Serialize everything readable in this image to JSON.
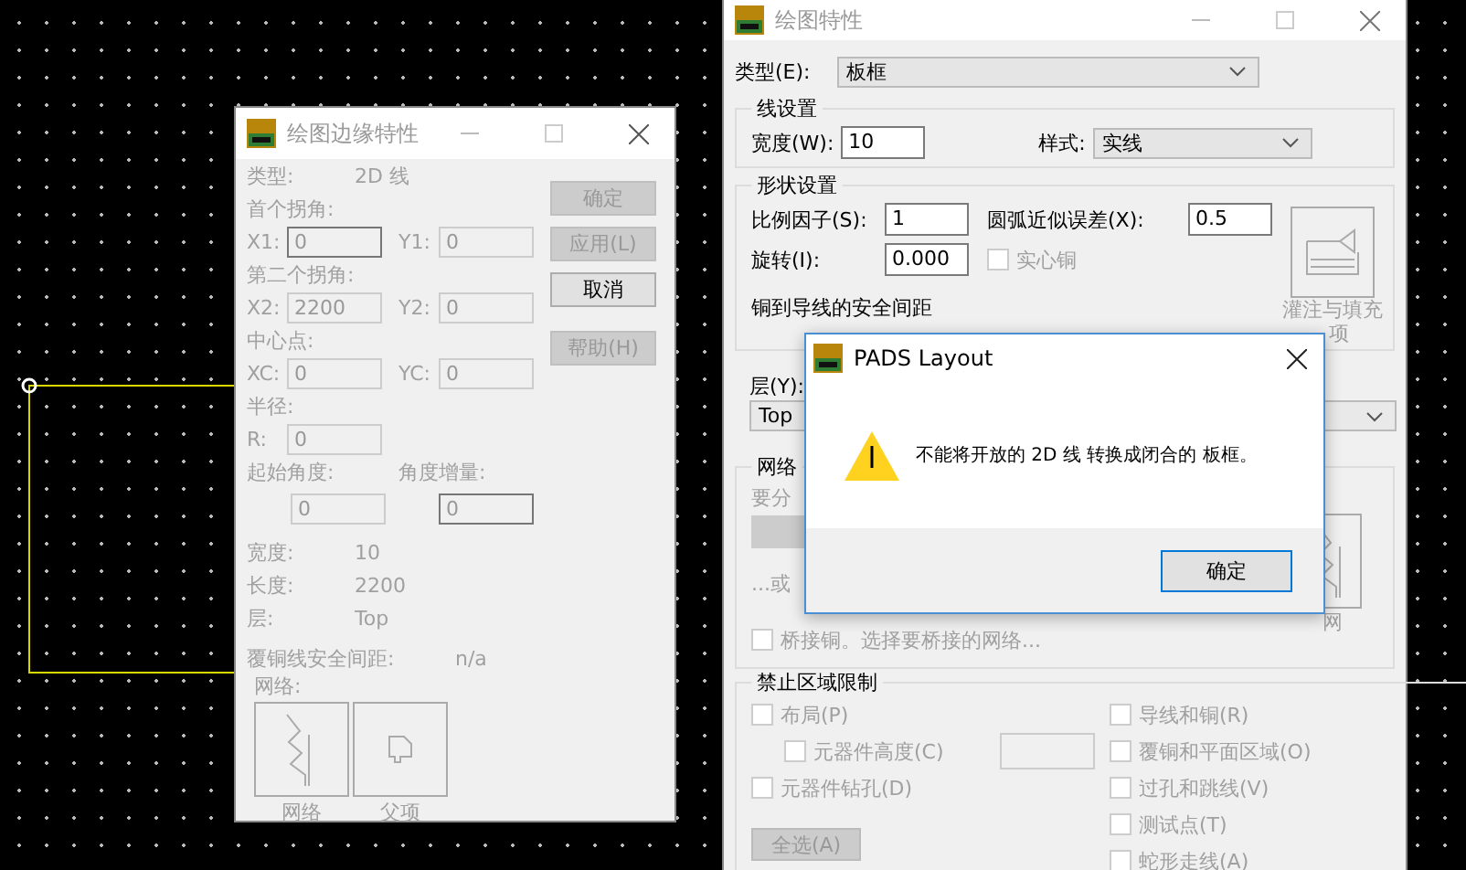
{
  "edge_dialog": {
    "title": "绘图边缘特性",
    "type_label": "类型:",
    "type_value": "2D 线",
    "sections": [
      {
        "heading": "首个拐角:",
        "fields": [
          {
            "label": "X1:",
            "value": "0",
            "focused": true
          },
          {
            "label": "Y1:",
            "value": "0",
            "focused": false
          }
        ]
      },
      {
        "heading": "第二个拐角:",
        "fields": [
          {
            "label": "X2:",
            "value": "2200",
            "focused": false
          },
          {
            "label": "Y2:",
            "value": "0",
            "focused": false
          }
        ]
      },
      {
        "heading": "中心点:",
        "fields": [
          {
            "label": "XC:",
            "value": "0",
            "focused": false
          },
          {
            "label": "YC:",
            "value": "0",
            "focused": false
          }
        ]
      },
      {
        "heading": "半径:",
        "fields": [
          {
            "label": "R:",
            "value": "0",
            "focused": false
          }
        ]
      }
    ],
    "angles": [
      {
        "label": "起始角度:",
        "value": "0",
        "focused": false
      },
      {
        "label": "角度增量:",
        "value": "0",
        "focused": true
      }
    ],
    "info": [
      {
        "label": "宽度:",
        "value": "10"
      },
      {
        "label": "长度:",
        "value": "2200"
      },
      {
        "label": "层:",
        "value": "Top"
      },
      {
        "label": "覆铜线安全间距:",
        "value": "n/a"
      }
    ],
    "net_label": "网络:",
    "tool_buttons": [
      {
        "label": "网络",
        "kind": "net"
      },
      {
        "label": "父项",
        "kind": "parent"
      }
    ],
    "buttons": [
      {
        "label": "确定",
        "disabled": true
      },
      {
        "label": "应用(L)",
        "disabled": true
      },
      {
        "label": "取消",
        "disabled": false
      },
      {
        "label": "帮助(H)",
        "disabled": true
      }
    ]
  },
  "drawing_dialog": {
    "title": "绘图特性",
    "type_label": "类型(E):",
    "type_value": "板框",
    "line_group": {
      "title": "线设置",
      "width_label": "宽度(W):",
      "width_value": "10",
      "style_label": "样式:",
      "style_value": "实线"
    },
    "shape_group": {
      "title": "形状设置",
      "scale_label": "比例因子(S):",
      "scale_value": "1",
      "arc_label": "圆弧近似误差(X):",
      "arc_value": "0.5",
      "rotation_label": "旋转(I):",
      "rotation_value": "0.000",
      "solid": {
        "label": "实心铜",
        "checked": false,
        "disabled": true
      },
      "pour_button": [
        "灌注与填充",
        "项"
      ],
      "clearance_label": "铜到导线的安全间距"
    },
    "layer_label": "层(Y):",
    "layer_value": "Top",
    "net_group": {
      "title": "网络",
      "hint": "要分",
      "or_label": "...或",
      "bridge": {
        "label": "桥接铜。选择要桥接的网络...",
        "checked": false
      },
      "net_button": "网"
    },
    "keepout_group": {
      "title": "禁止区域限制",
      "left": [
        {
          "label": "布局(P)",
          "checked": false,
          "children": [
            {
              "label": "元器件高度(C)",
              "checked": false
            }
          ]
        },
        {
          "label": "元器件钻孔(D)",
          "checked": false
        }
      ],
      "right": [
        {
          "label": "导线和铜(R)",
          "checked": false
        },
        {
          "label": "覆铜和平面区域(O)",
          "checked": false
        },
        {
          "label": "过孔和跳线(V)",
          "checked": false
        },
        {
          "label": "测试点(T)",
          "checked": false
        },
        {
          "label": "蛇形走线(A)",
          "checked": false
        }
      ],
      "select_all": "全选(A)"
    }
  },
  "message_box": {
    "title": "PADS Layout",
    "message": "不能将开放的 2D 线 转换成闭合的 板框。",
    "button": "确定"
  }
}
